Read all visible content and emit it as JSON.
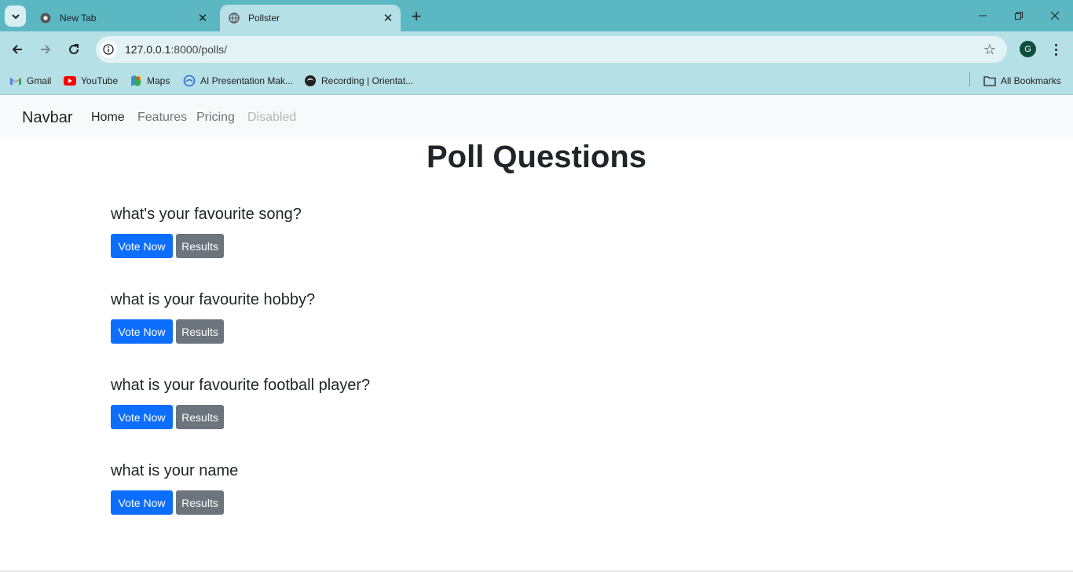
{
  "browser": {
    "tabs": [
      {
        "title": "New Tab",
        "icon": "chrome-icon",
        "active": false
      },
      {
        "title": "Pollster",
        "icon": "globe-icon",
        "active": true
      }
    ],
    "address": {
      "host": "127.0.0.1",
      "rest": ":8000/polls/"
    },
    "profile_initial": "G",
    "bookmarks": [
      {
        "label": "Gmail",
        "icon": "gmail-icon"
      },
      {
        "label": "YouTube",
        "icon": "youtube-icon"
      },
      {
        "label": "Maps",
        "icon": "maps-icon"
      },
      {
        "label": "AI Presentation Mak...",
        "icon": "ai-globe-icon"
      },
      {
        "label": "Recording | Orientat...",
        "icon": "recording-icon"
      }
    ],
    "all_bookmarks_label": "All Bookmarks"
  },
  "navbar": {
    "brand": "Navbar",
    "links": [
      {
        "label": "Home",
        "state": "active"
      },
      {
        "label": "Features",
        "state": "normal"
      },
      {
        "label": "Pricing",
        "state": "normal"
      },
      {
        "label": "Disabled",
        "state": "disabled"
      }
    ]
  },
  "page": {
    "title": "Poll Questions",
    "polls": [
      {
        "question": "what's your favourite song?",
        "vote_label": "Vote Now",
        "results_label": "Results"
      },
      {
        "question": "what is your favourite hobby?",
        "vote_label": "Vote Now",
        "results_label": "Results"
      },
      {
        "question": "what is your favourite football player?",
        "vote_label": "Vote Now",
        "results_label": "Results"
      },
      {
        "question": "what is your name",
        "vote_label": "Vote Now",
        "results_label": "Results"
      }
    ]
  },
  "colors": {
    "tabstrip": "#5bb8c3",
    "toolbar": "#b5e0e5",
    "primary_button": "#0d6efd",
    "secondary_button": "#6c757d",
    "navbar_bg": "#f8f9fa"
  }
}
